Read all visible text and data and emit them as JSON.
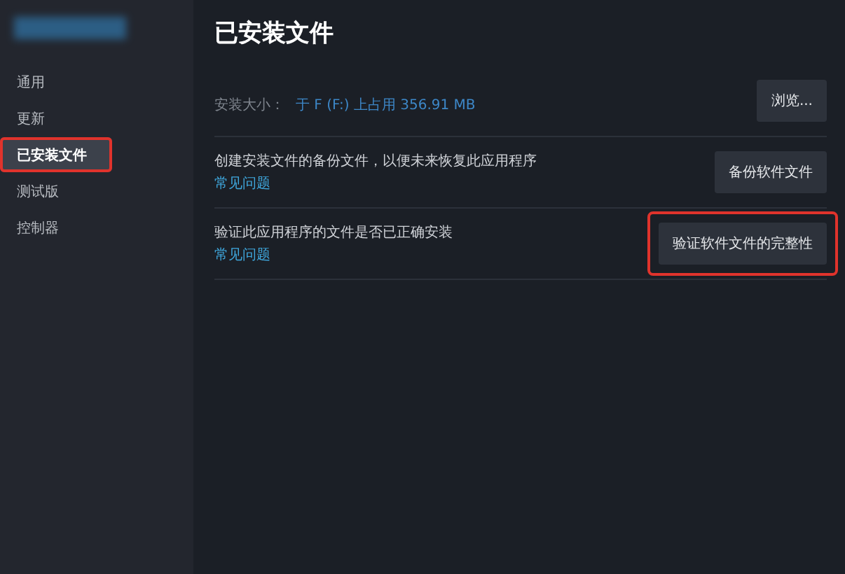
{
  "sidebar": {
    "items": [
      {
        "label": "通用",
        "selected": false,
        "highlighted": false
      },
      {
        "label": "更新",
        "selected": false,
        "highlighted": false
      },
      {
        "label": "已安装文件",
        "selected": true,
        "highlighted": true
      },
      {
        "label": "测试版",
        "selected": false,
        "highlighted": false
      },
      {
        "label": "控制器",
        "selected": false,
        "highlighted": false
      }
    ]
  },
  "main": {
    "title": "已安装文件",
    "size_row": {
      "label": "安装大小：",
      "value": "于 F (F:) 上占用 356.91 MB",
      "button": {
        "label": "浏览...",
        "highlighted": false
      }
    },
    "rows": [
      {
        "text": "创建安装文件的备份文件，以便未来恢复此应用程序",
        "link": "常见问题",
        "button": {
          "label": "备份软件文件",
          "highlighted": false
        }
      },
      {
        "text": "验证此应用程序的文件是否已正确安装",
        "link": "常见问题",
        "button": {
          "label": "验证软件文件的完整性",
          "highlighted": true
        }
      }
    ]
  }
}
